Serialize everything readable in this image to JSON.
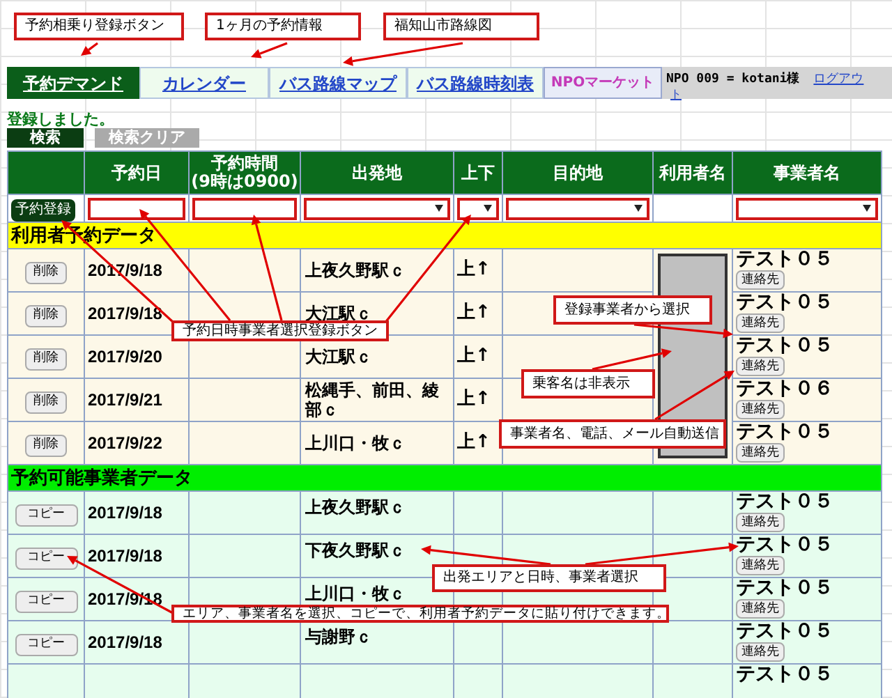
{
  "callouts": [
    {
      "text": "予約相乗り登録ボタン"
    },
    {
      "text": "1ヶ月の予約情報"
    },
    {
      "text": "福知山市路線図"
    },
    {
      "text": "予約日時事業者選択登録ボタン"
    },
    {
      "text": "登録事業者から選択"
    },
    {
      "text": "乗客名は非表示"
    },
    {
      "text": "事業者名、電話、メール自動送信"
    },
    {
      "text": "出発エリアと日時、事業者選択"
    },
    {
      "text": "エリア、事業者名を選択、コピーで、利用者予約データに貼り付けできます。"
    }
  ],
  "nav": {
    "tabs": [
      {
        "label": "予約デマンド",
        "selected": true
      },
      {
        "label": "カレンダー",
        "selected": false
      },
      {
        "label": "バス路線マップ",
        "selected": false
      },
      {
        "label": "バス路線時刻表",
        "selected": false
      }
    ],
    "market_logo": "NPOマーケット",
    "user": "NPO 009 = kotani様",
    "logout": "ログアウ",
    "logout_wrap": "ト"
  },
  "message": "登録しました。",
  "search_buttons": [
    {
      "label": "検索",
      "selected": true
    },
    {
      "label": "検索クリア",
      "selected": false
    }
  ],
  "table": {
    "columns": [
      {
        "label": "予約日"
      },
      {
        "label": "予約時間",
        "note": "(9時は0900)"
      },
      {
        "label": "出発地"
      },
      {
        "label": "上下"
      },
      {
        "label": "目的地"
      },
      {
        "label": "利用者名"
      },
      {
        "label": "事業者名"
      }
    ],
    "entry_row": {
      "button": "予約登録",
      "fields": [
        {
          "kind": "text"
        },
        {
          "kind": "text"
        },
        {
          "kind": "select"
        },
        {
          "kind": "select"
        },
        {
          "kind": "select"
        },
        {
          "kind": "none"
        },
        {
          "kind": "select"
        }
      ]
    },
    "sections": [
      {
        "title": "利用者予約データ",
        "kind": "user",
        "rows": [
          {
            "button": "削除",
            "date": "2017/9/18",
            "origin": "上夜久野駅ｃ",
            "direction": "上↑",
            "operator": "テスト０５",
            "contact": "連絡先"
          },
          {
            "button": "削除",
            "date": "2017/9/18",
            "origin": "大江駅ｃ",
            "direction": "上↑",
            "operator": "テスト０５",
            "contact": "連絡先"
          },
          {
            "button": "削除",
            "date": "2017/9/20",
            "origin": "大江駅ｃ",
            "direction": "上↑",
            "operator": "テスト０５",
            "contact": "連絡先"
          },
          {
            "button": "削除",
            "date": "2017/9/21",
            "origin": "松縄手、前田、綾部ｃ",
            "direction": "上↑",
            "operator": "テスト０６",
            "contact": "連絡先"
          },
          {
            "button": "削除",
            "date": "2017/9/22",
            "origin": "上川口・牧ｃ",
            "direction": "上↑",
            "operator": "テスト０５",
            "contact": "連絡先"
          }
        ]
      },
      {
        "title": "予約可能事業者データ",
        "kind": "provider",
        "rows": [
          {
            "button": "コピー",
            "date": "2017/9/18",
            "origin": "上夜久野駅ｃ",
            "operator": "テスト０５",
            "contact": "連絡先"
          },
          {
            "button": "コピー",
            "date": "2017/9/18",
            "origin": "下夜久野駅ｃ",
            "operator": "テスト０５",
            "contact": "連絡先"
          },
          {
            "button": "コピー",
            "date": "2017/9/18",
            "origin": "上川口・牧ｃ",
            "operator": "テスト０５",
            "contact": "連絡先"
          },
          {
            "button": "コピー",
            "date": "2017/9/18",
            "origin": "与謝野ｃ",
            "operator": "テスト０５",
            "contact": "連絡先"
          },
          {
            "operator": "テスト０５"
          }
        ]
      }
    ]
  }
}
